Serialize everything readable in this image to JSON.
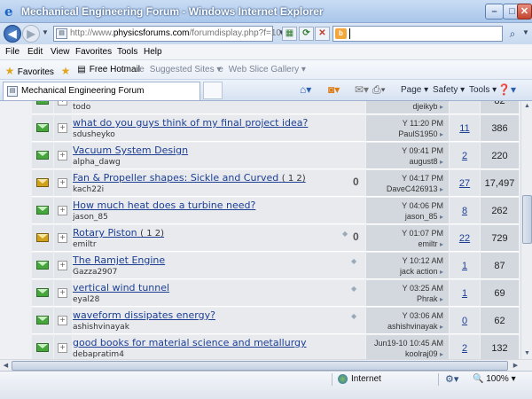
{
  "window": {
    "title": "Mechanical Engineering Forum - Windows Internet Explorer",
    "min_glyph": "–",
    "max_glyph": "□",
    "close_glyph": "✕"
  },
  "address": {
    "url_prefix": "http://www.",
    "url_domain": "physicsforums.com",
    "url_suffix": "/forumdisplay.php?f=101"
  },
  "menu": [
    "File",
    "Edit",
    "View",
    "Favorites",
    "Tools",
    "Help"
  ],
  "favorites_bar": {
    "favorites_label": "Favorites",
    "items": [
      {
        "label": "Free Hotmail",
        "grey": false
      },
      {
        "label": "Suggested Sites ▾",
        "grey": true
      },
      {
        "label": "Web Slice Gallery ▾",
        "grey": true
      }
    ]
  },
  "tab": {
    "label": "Mechanical Engineering Forum"
  },
  "commands": {
    "page": "Page ▾",
    "safety": "Safety ▾",
    "tools": "Tools ▾"
  },
  "threads": [
    {
      "title": "",
      "pages": "",
      "author": "todo",
      "last_time": "",
      "last_user": "djeikyb",
      "replies": "",
      "views": "82",
      "hot": false,
      "clip": false,
      "rated": false
    },
    {
      "title": "what do you guys think of my final project idea?",
      "pages": "",
      "author": "sdusheyko",
      "last_time": "Y 11:20 PM",
      "last_user": "PaulS1950",
      "replies": "11",
      "views": "386",
      "hot": false,
      "clip": false,
      "rated": false
    },
    {
      "title": "Vacuum System Design",
      "pages": "",
      "author": "alpha_dawg",
      "last_time": "Y 09:41 PM",
      "last_user": "august8",
      "replies": "2",
      "views": "220",
      "hot": false,
      "clip": false,
      "rated": false
    },
    {
      "title": "Fan & Propeller shapes: Sickle and Curved",
      "pages": "( 1 2)",
      "author": "kach22i",
      "last_time": "Y 04:17 PM",
      "last_user": "DaveC426913",
      "replies": "27",
      "views": "17,497",
      "hot": true,
      "clip": true,
      "rated": false
    },
    {
      "title": "How much heat does a turbine need?",
      "pages": "",
      "author": "jason_85",
      "last_time": "Y 04:06 PM",
      "last_user": "jason_85",
      "replies": "8",
      "views": "262",
      "hot": false,
      "clip": false,
      "rated": false
    },
    {
      "title": "Rotary Piston",
      "pages": "( 1 2)",
      "author": "emiltr",
      "last_time": "Y 01:07 PM",
      "last_user": "emiltr",
      "replies": "22",
      "views": "729",
      "hot": true,
      "clip": true,
      "rated": true
    },
    {
      "title": "The Ramjet Engine",
      "pages": "",
      "author": "Gazza2907",
      "last_time": "Y 10:12 AM",
      "last_user": "jack action",
      "replies": "1",
      "views": "87",
      "hot": false,
      "clip": false,
      "rated": true
    },
    {
      "title": "vertical wind tunnel",
      "pages": "",
      "author": "eyal28",
      "last_time": "Y 03:25 AM",
      "last_user": "Phrak",
      "replies": "1",
      "views": "69",
      "hot": false,
      "clip": false,
      "rated": true
    },
    {
      "title": "waveform dissipates energy?",
      "pages": "",
      "author": "ashishvinayak",
      "last_time": "Y 03:06 AM",
      "last_user": "ashishvinayak",
      "replies": "0",
      "views": "62",
      "hot": false,
      "clip": false,
      "rated": true
    },
    {
      "title": "good books for material science and metallurgy",
      "pages": "",
      "author": "debapratim4",
      "last_time": "Jun19-10 10:45 AM",
      "last_user": "koolraj09",
      "replies": "2",
      "views": "132",
      "hot": false,
      "clip": false,
      "rated": false
    }
  ],
  "status": {
    "zone": "Internet",
    "zoom": "100%"
  },
  "colors": {
    "link": "#1c3f94",
    "folder_new": "#46a63d",
    "folder_hot": "#d0a21c"
  }
}
